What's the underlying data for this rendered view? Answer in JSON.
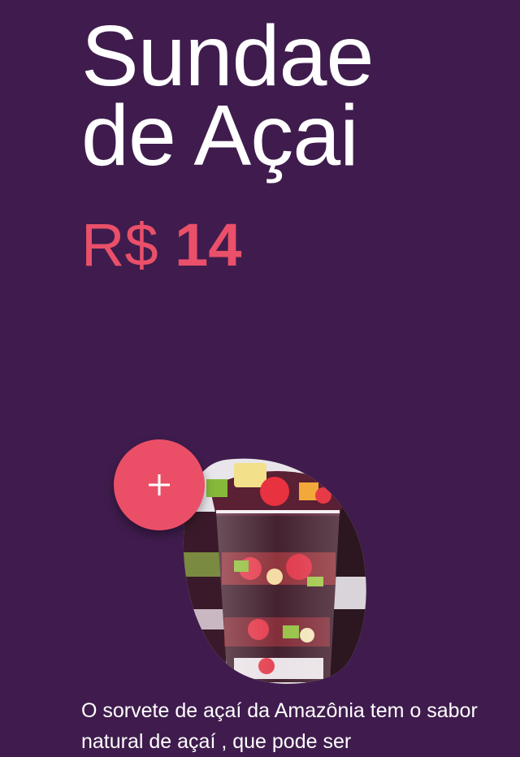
{
  "product": {
    "title_line1": "Sundae",
    "title_line2": "de Açai",
    "price_currency": "R$",
    "price_amount": "14",
    "description": "O sorvete de açaí da Amazônia tem o sabor natural de açaí , que pode ser"
  },
  "add_button": {
    "icon": "plus-icon"
  },
  "image": {
    "subject": "acai-sundae-cups"
  },
  "colors": {
    "background": "#3f1c4d",
    "accent": "#eb4f67",
    "title_text": "#ffffff"
  }
}
